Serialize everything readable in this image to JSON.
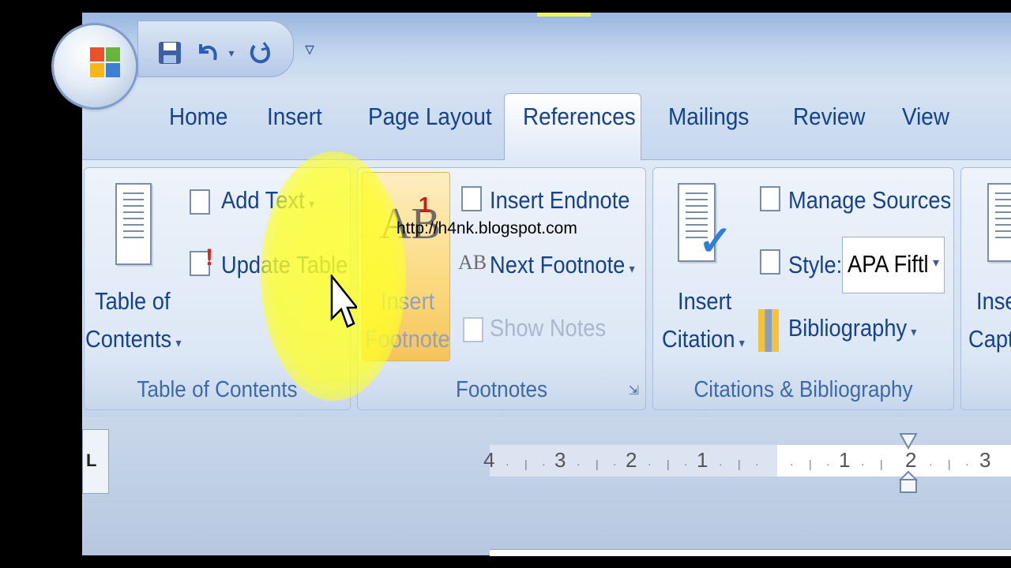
{
  "qat": {
    "save_icon": "save-icon",
    "undo_icon": "undo-icon",
    "redo_icon": "redo-icon",
    "more_glyph": "▿"
  },
  "tabs": [
    {
      "label": "Home"
    },
    {
      "label": "Insert"
    },
    {
      "label": "Page Layout"
    },
    {
      "label": "References"
    },
    {
      "label": "Mailings"
    },
    {
      "label": "Review"
    },
    {
      "label": "View"
    }
  ],
  "groups": {
    "toc": {
      "label": "Table of Contents",
      "big_button": "Table of\nContents",
      "big_button_l1": "Table of",
      "big_button_l2": "Contents",
      "add_text": "Add Text",
      "update_table": "Update Table"
    },
    "footnotes": {
      "label": "Footnotes",
      "insert_footnote_l1": "Insert",
      "insert_footnote_l2": "Footnote",
      "insert_endnote": "Insert Endnote",
      "next_footnote": "Next Footnote",
      "show_notes": "Show Notes"
    },
    "citations": {
      "label": "Citations & Bibliography",
      "insert_citation_l1": "Insert",
      "insert_citation_l2": "Citation",
      "manage_sources": "Manage Sources",
      "style_label": "Style:",
      "style_value": "APA Fiftl",
      "bibliography": "Bibliography"
    },
    "captions": {
      "insert_caption_l1": "Inse",
      "insert_caption_l2": "Capt"
    }
  },
  "watermark": "http://h4nk.blogspot.com",
  "ruler": {
    "corner_glyph": "L",
    "numbers_left": [
      "4",
      "3",
      "2",
      "1"
    ],
    "numbers_right": [
      "1",
      "2",
      "3"
    ]
  },
  "colors": {
    "tab_text": "#15428b",
    "highlight": "#ffff28",
    "footnote_highlight": "#fbd97e"
  }
}
